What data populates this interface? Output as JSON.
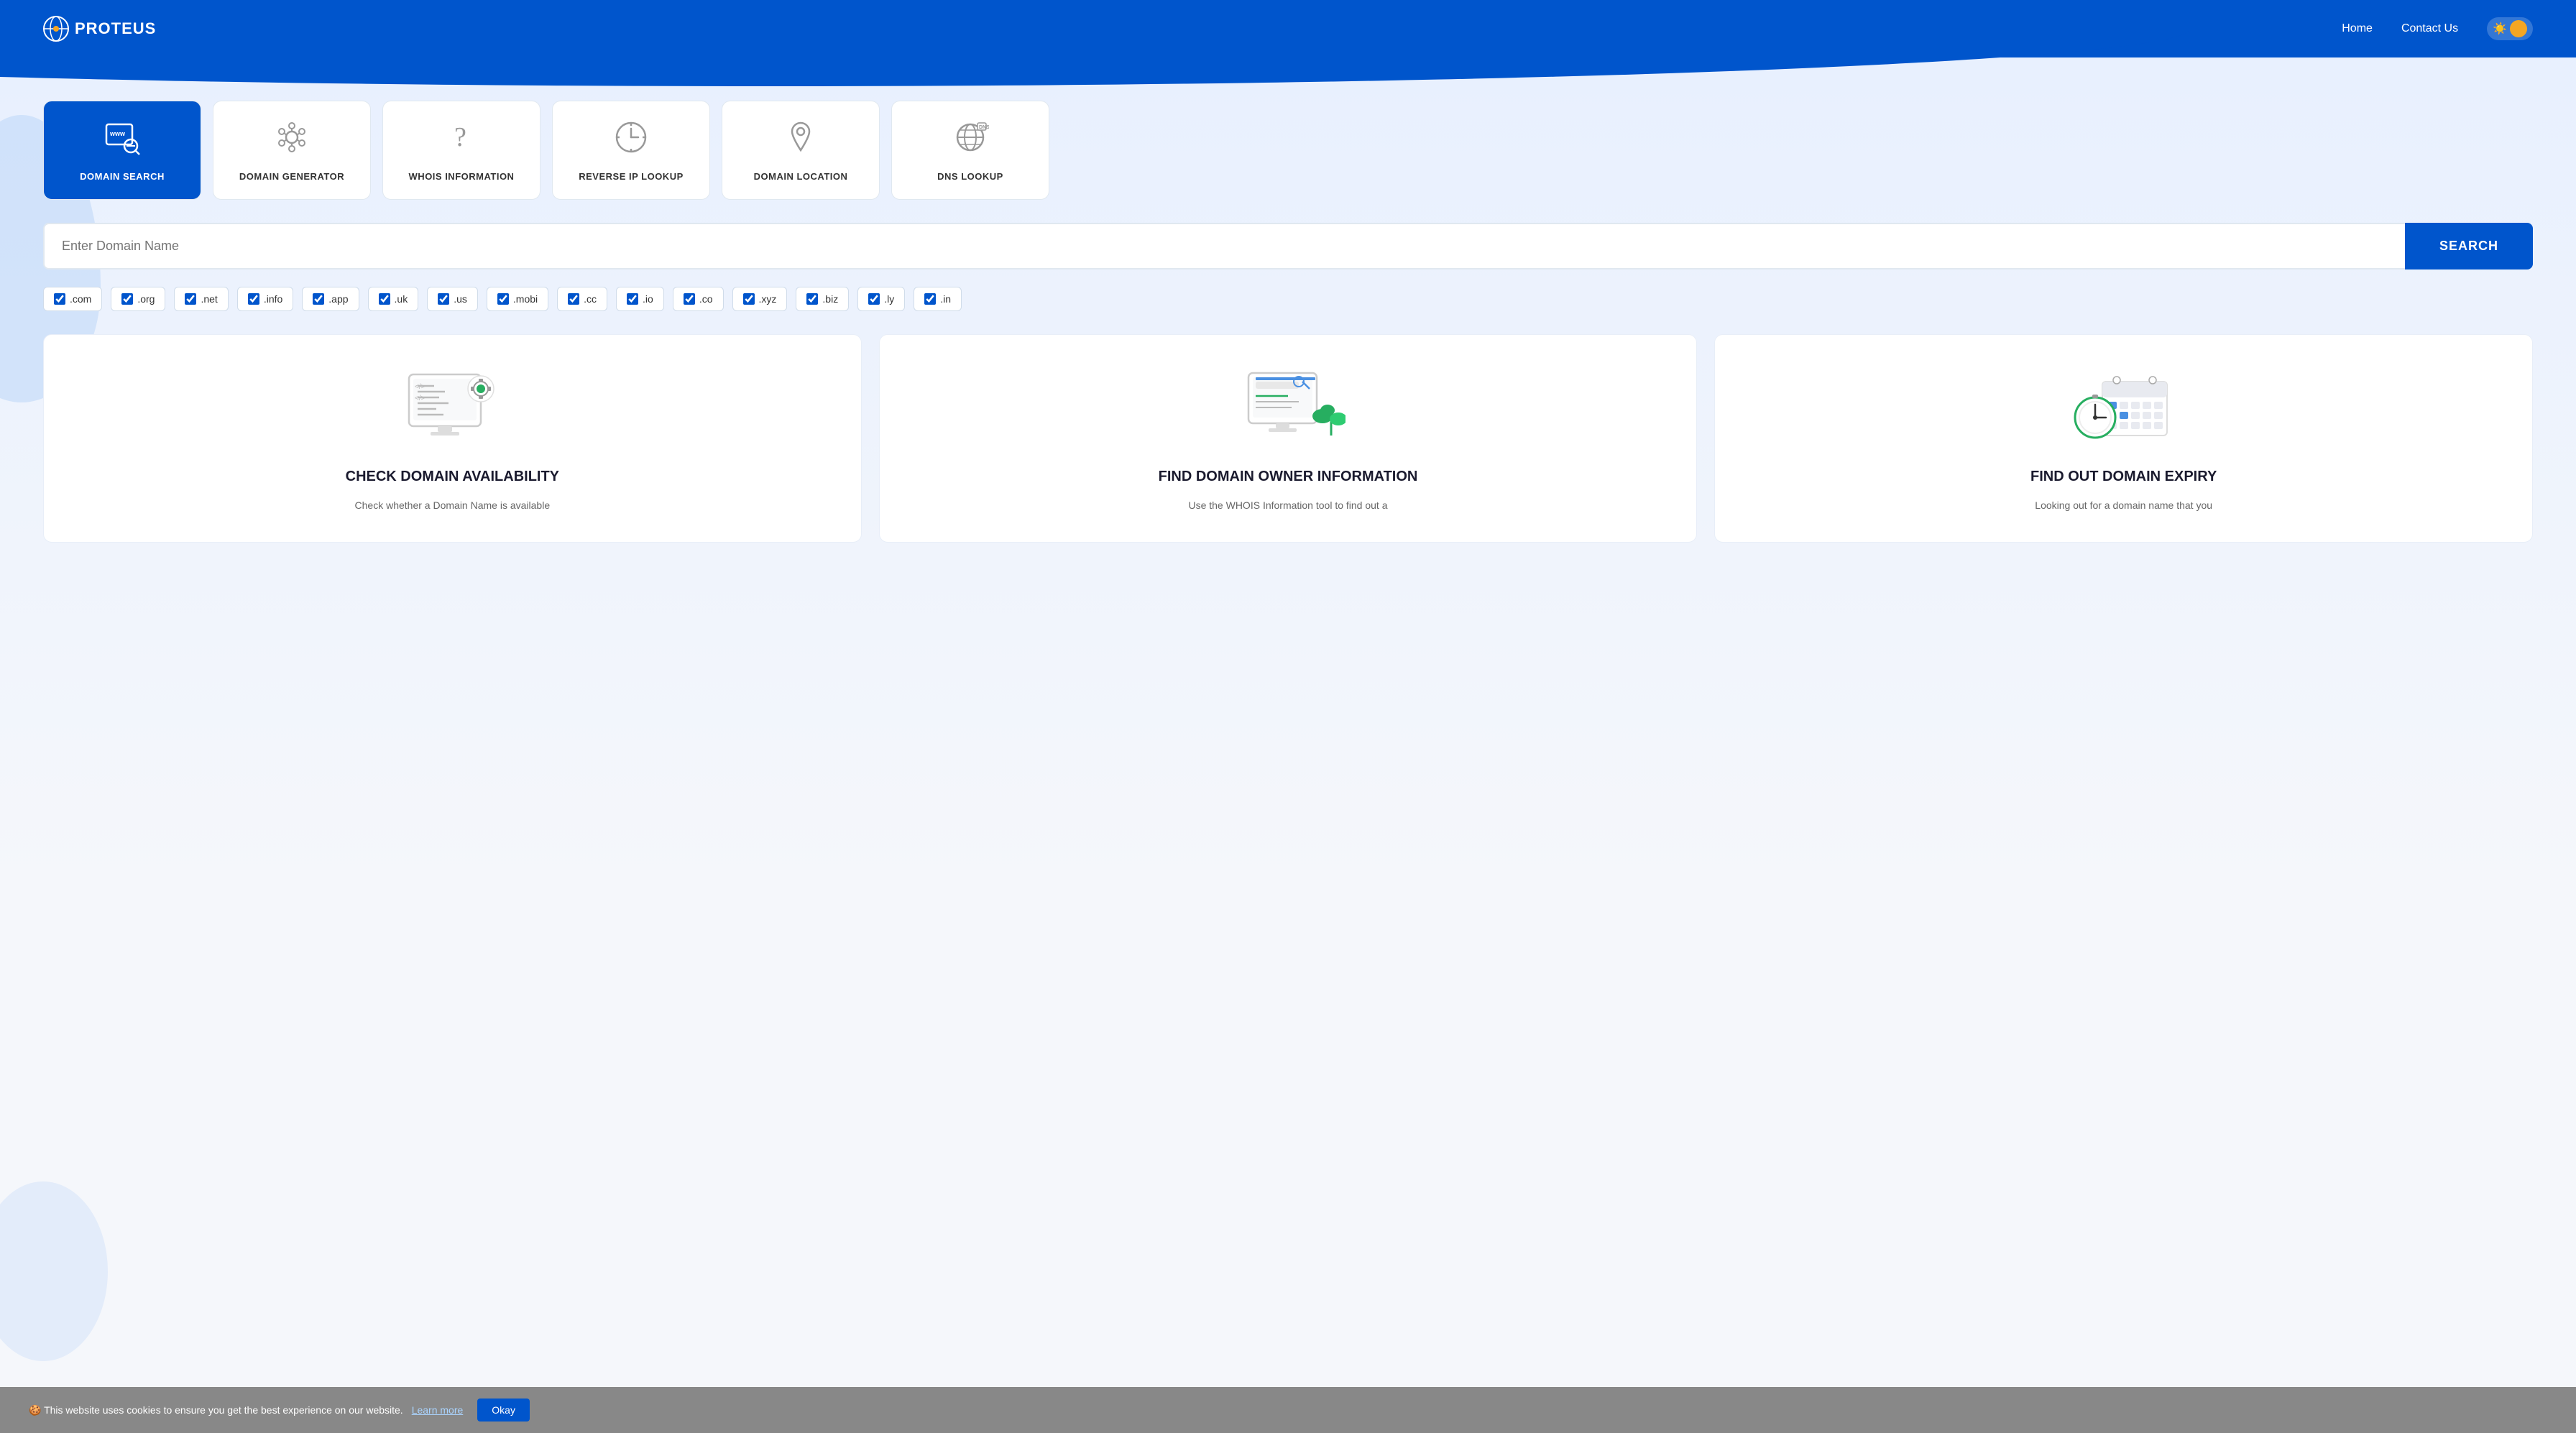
{
  "header": {
    "logo_text": "PROTEUS",
    "nav_items": [
      {
        "label": "Home",
        "href": "#"
      },
      {
        "label": "Contact Us",
        "href": "#"
      }
    ],
    "theme_toggle_label": "theme-toggle"
  },
  "tools": [
    {
      "id": "domain-search",
      "label": "DOMAIN SEARCH",
      "active": true,
      "icon": "www-search"
    },
    {
      "id": "domain-generator",
      "label": "DOMAIN GENERATOR",
      "active": false,
      "icon": "gear-network"
    },
    {
      "id": "whois-information",
      "label": "WHOIS INFORMATION",
      "active": false,
      "icon": "question"
    },
    {
      "id": "reverse-ip-lookup",
      "label": "REVERSE IP LOOKUP",
      "active": false,
      "icon": "clock"
    },
    {
      "id": "domain-location",
      "label": "DOMAIN LOCATION",
      "active": false,
      "icon": "location-pin"
    },
    {
      "id": "dns-lookup",
      "label": "DNS LOOKUP",
      "active": false,
      "icon": "dns-globe"
    }
  ],
  "search": {
    "placeholder": "Enter Domain Name",
    "button_label": "SEARCH"
  },
  "tlds": [
    ".com",
    ".org",
    ".net",
    ".info",
    ".app",
    ".uk",
    ".us",
    ".mobi",
    ".cc",
    ".io",
    ".co",
    ".xyz",
    ".biz",
    ".ly",
    ".in"
  ],
  "features": [
    {
      "id": "check-domain",
      "title": "CHECK DOMAIN AVAILABILITY",
      "description": "Check whether a Domain Name is available"
    },
    {
      "id": "find-owner",
      "title": "FIND DOMAIN OWNER INFORMATION",
      "description": "Use the WHOIS Information tool to find out a"
    },
    {
      "id": "find-expiry",
      "title": "FIND OUT DOMAIN EXPIRY",
      "description": "Looking out for a domain name that you"
    }
  ],
  "cookie": {
    "message": "🍪 This website uses cookies to ensure you get the best experience on our website.",
    "learn_more_label": "Learn more",
    "okay_label": "Okay"
  }
}
